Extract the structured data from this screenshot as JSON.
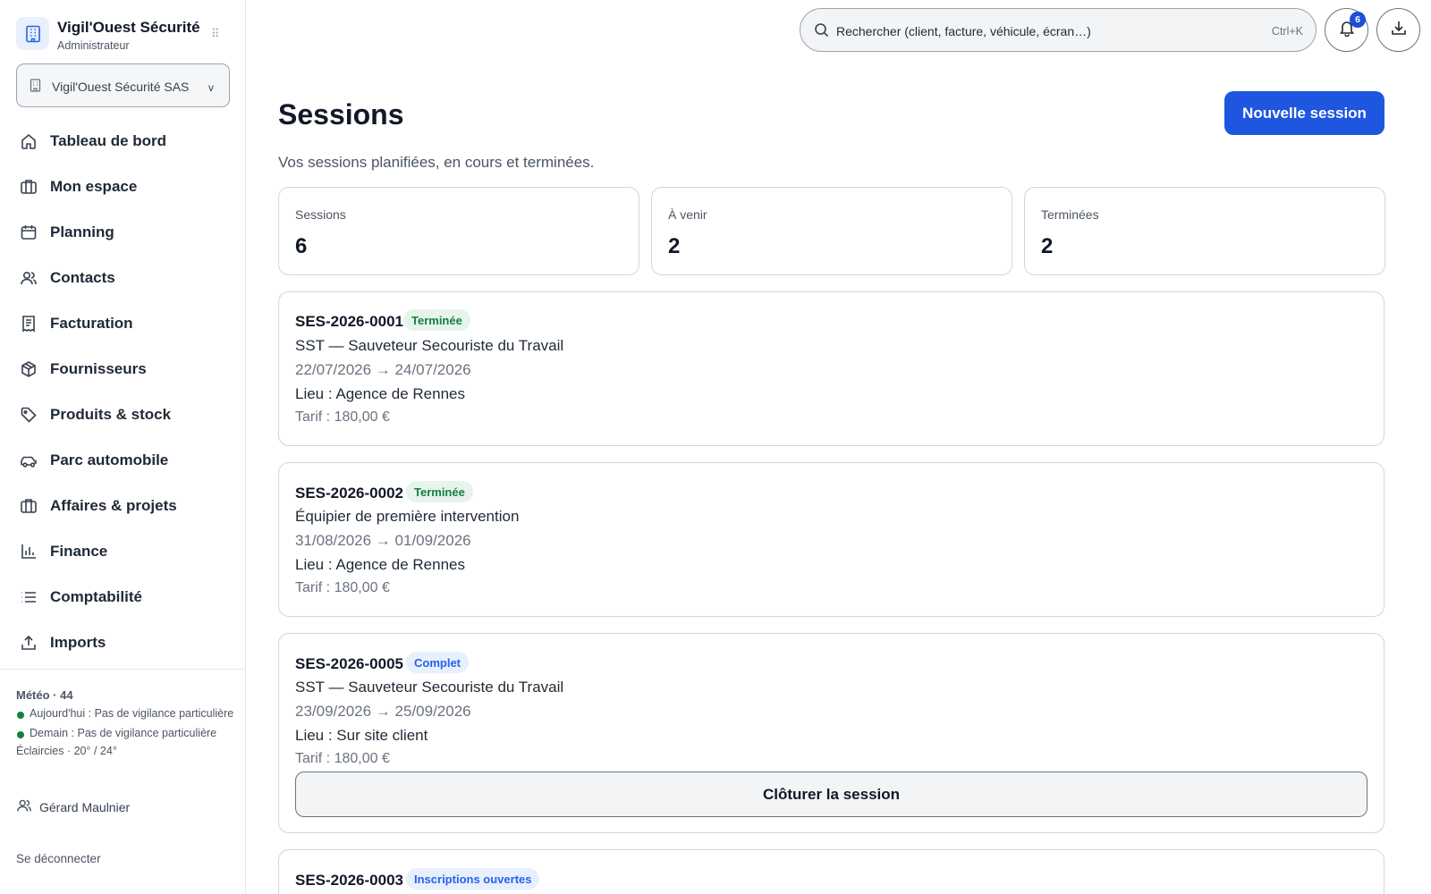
{
  "brand": {
    "name": "Vigil'Ouest Sécurité",
    "role": "Administrateur",
    "organization": "Vigil'Ouest Sécurité SAS",
    "org_chevron": "v"
  },
  "nav": {
    "items": [
      {
        "label": "Tableau de bord",
        "icon": "home-icon"
      },
      {
        "label": "Mon espace",
        "icon": "briefcase-icon"
      },
      {
        "label": "Planning",
        "icon": "calendar-icon"
      },
      {
        "label": "Contacts",
        "icon": "users-icon"
      },
      {
        "label": "Facturation",
        "icon": "receipt-icon"
      },
      {
        "label": "Fournisseurs",
        "icon": "package-icon"
      },
      {
        "label": "Produits & stock",
        "icon": "tag-icon"
      },
      {
        "label": "Parc automobile",
        "icon": "car-icon"
      },
      {
        "label": "Affaires & projets",
        "icon": "briefcase-icon"
      },
      {
        "label": "Finance",
        "icon": "bar-chart-icon"
      },
      {
        "label": "Comptabilité",
        "icon": "list-icon"
      },
      {
        "label": "Imports",
        "icon": "upload-icon"
      }
    ]
  },
  "weather": {
    "title": "Météo · 44",
    "today": "Aujourd'hui : Pas de vigilance particulière",
    "tomorrow": "Demain : Pas de vigilance particulière",
    "sky": "Éclaircies · 20° / 24°",
    "status_color": "#15803d"
  },
  "user": {
    "name": "Gérard Maulnier",
    "logout_label": "Se déconnecter"
  },
  "topbar": {
    "search_placeholder": "Rechercher (client, facture, véhicule, écran…)",
    "search_shortcut": "Ctrl+K",
    "notifications_count": "6"
  },
  "page": {
    "title": "Sessions",
    "subtitle": "Vos sessions planifiées, en cours et terminées.",
    "new_button": "Nouvelle session"
  },
  "stats": [
    {
      "label": "Sessions",
      "value": "6"
    },
    {
      "label": "À venir",
      "value": "2"
    },
    {
      "label": "Terminées",
      "value": "2"
    }
  ],
  "sessions": [
    {
      "id": "SES-2026-0001",
      "status": "Terminée",
      "title": "SST — Sauveteur Secouriste du Travail",
      "dates": "22/07/2026 → 24/07/2026",
      "place": "Lieu : Agence de Rennes",
      "price": "Tarif : 180,00 €"
    },
    {
      "id": "SES-2026-0002",
      "status": "Terminée",
      "title": "Équipier de première intervention",
      "dates": "31/08/2026 → 01/09/2026",
      "place": "Lieu : Agence de Rennes",
      "price": "Tarif : 180,00 €"
    },
    {
      "id": "SES-2026-0005",
      "status": "Complet",
      "title": "SST — Sauveteur Secouriste du Travail",
      "dates": "23/09/2026 → 25/09/2026",
      "place": "Lieu : Sur site client",
      "price": "Tarif : 180,00 €",
      "action": "Clôturer la session"
    },
    {
      "id": "SES-2026-0003",
      "status": "Inscriptions ouvertes"
    }
  ],
  "colors": {
    "accent": "#1f56e0",
    "status_done": "#15803d",
    "status_info": "#2563eb"
  }
}
